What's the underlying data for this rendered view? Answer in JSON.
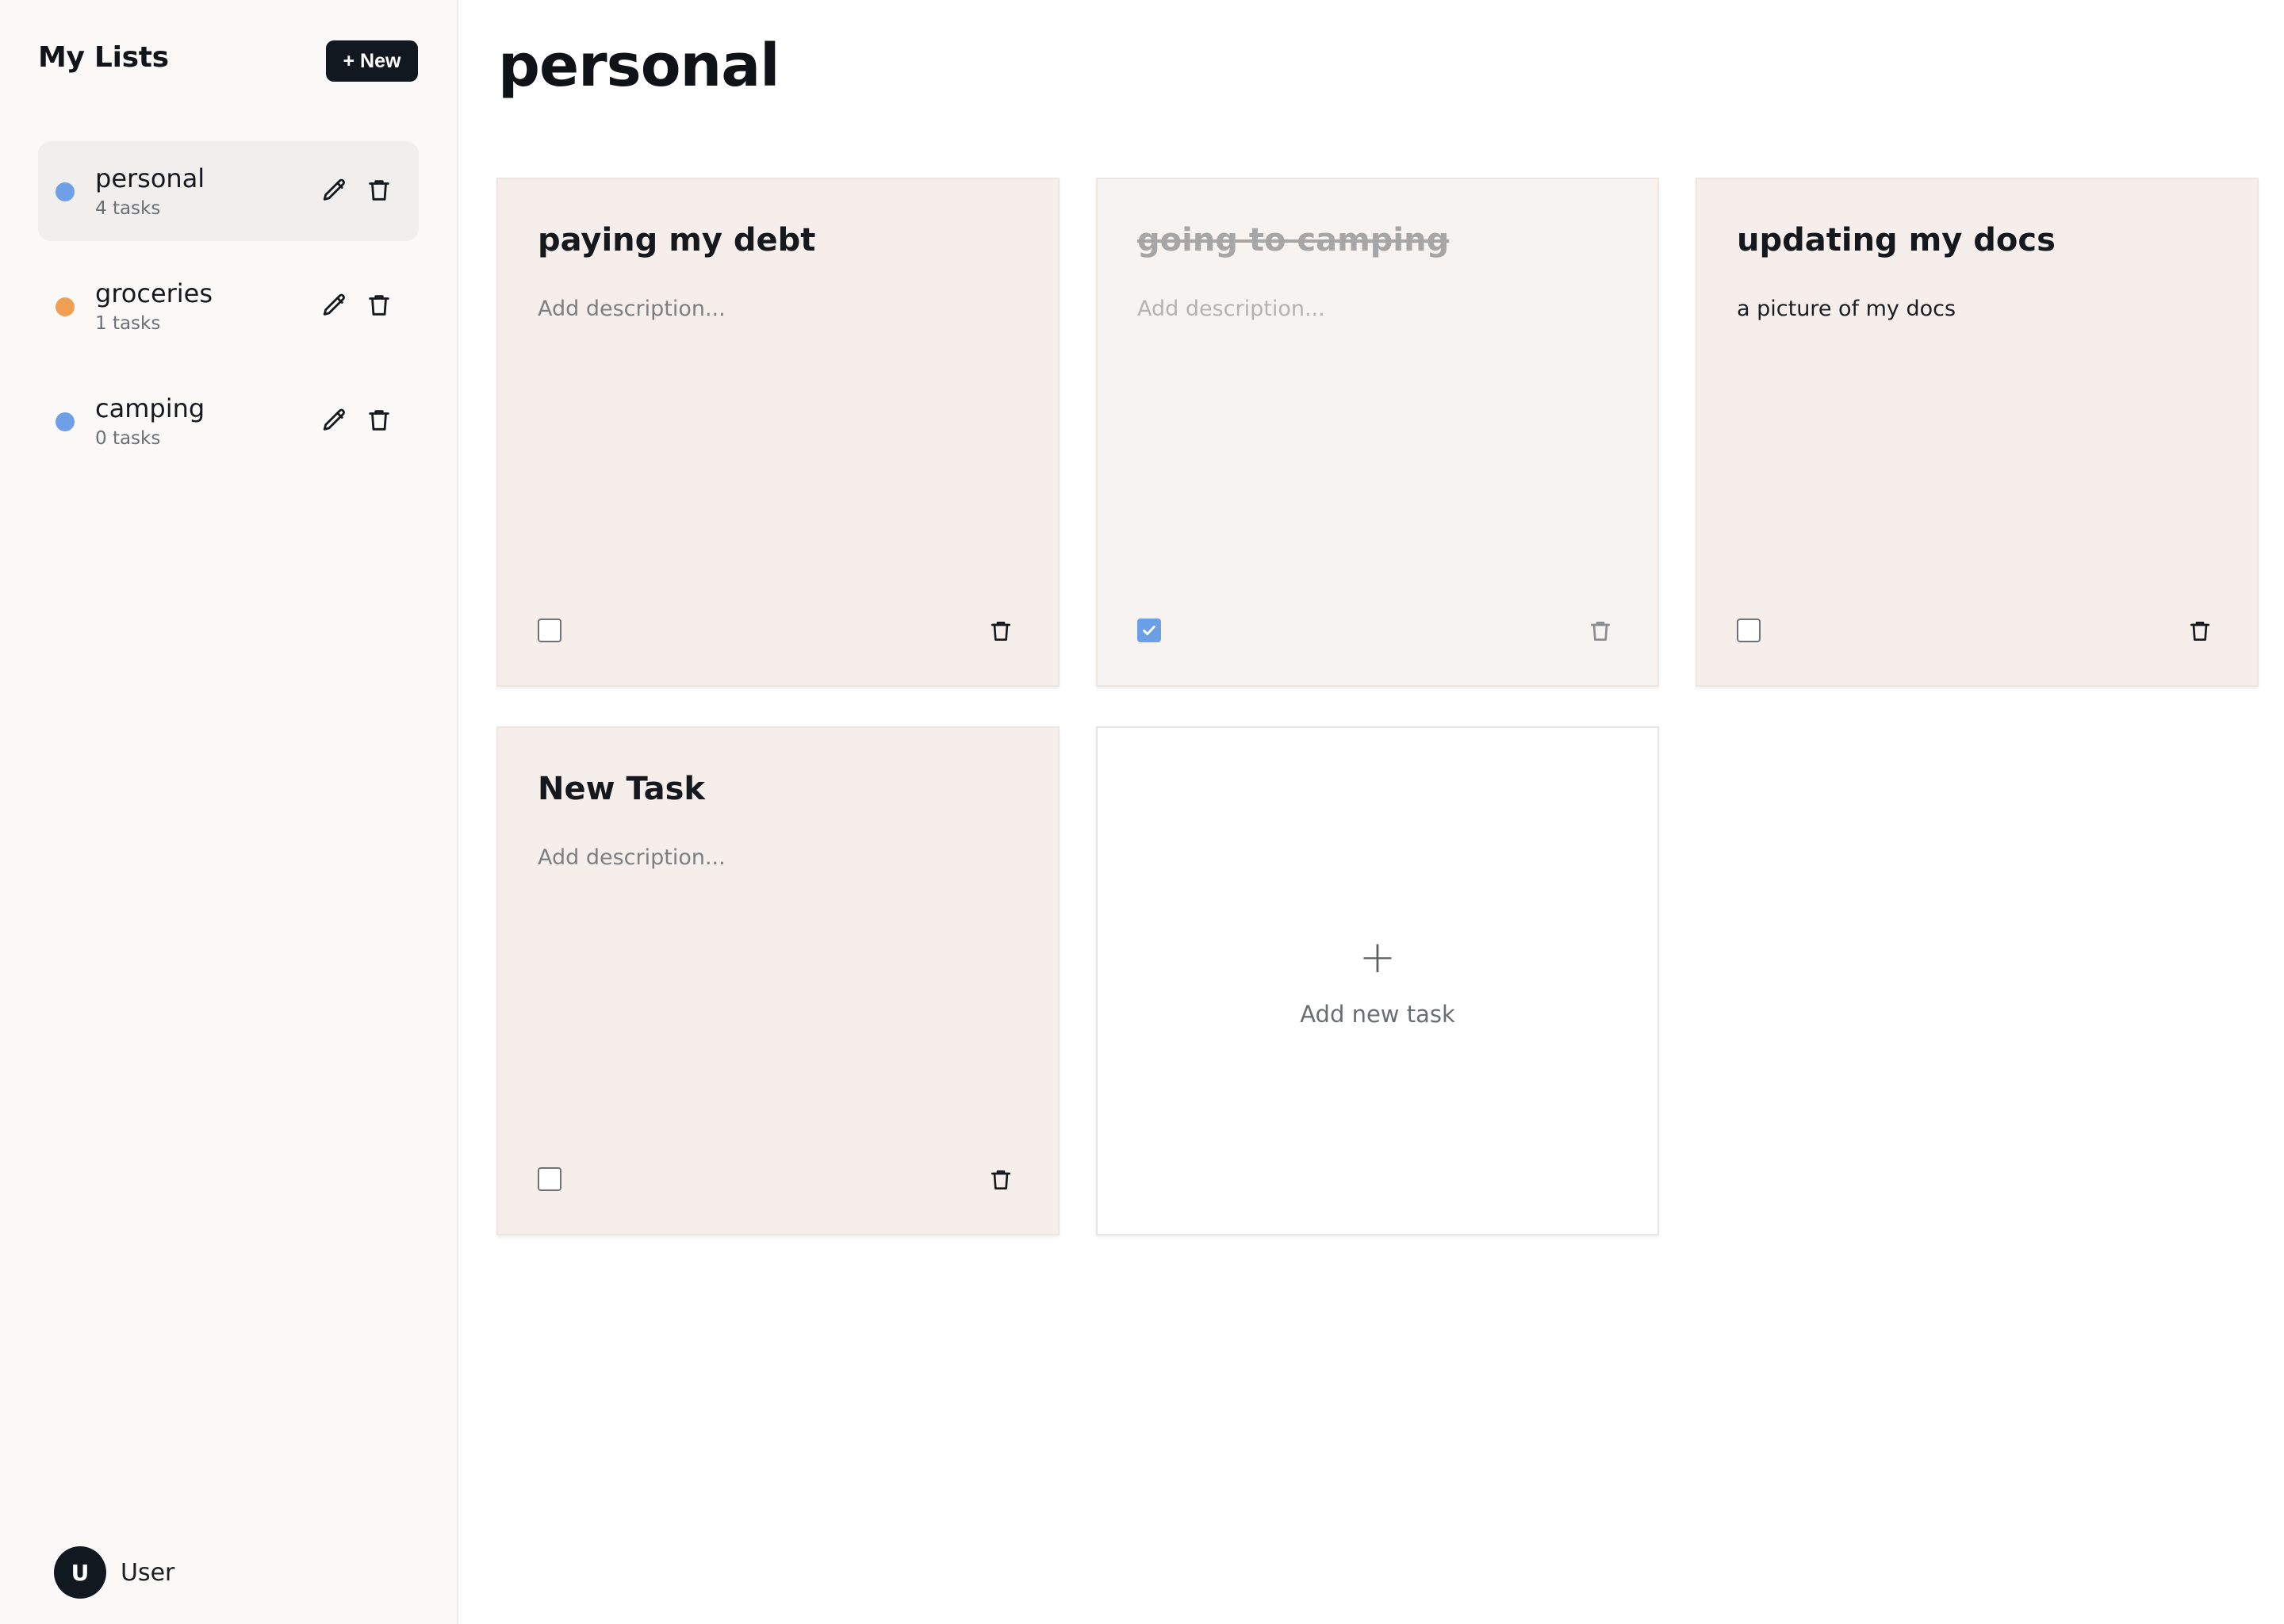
{
  "sidebar": {
    "title": "My Lists",
    "new_button_label": "+ New",
    "lists": [
      {
        "name": "personal",
        "count": "4 tasks",
        "color": "#6f9fe6",
        "active": true
      },
      {
        "name": "groceries",
        "count": "1 tasks",
        "color": "#f0a055",
        "active": false
      },
      {
        "name": "camping",
        "count": "0 tasks",
        "color": "#6f9fe6",
        "active": false
      }
    ],
    "user": {
      "initial": "U",
      "name": "User"
    }
  },
  "main": {
    "title": "personal",
    "tasks": [
      {
        "title": "paying my debt",
        "description": "Add description...",
        "done": false
      },
      {
        "title": "going to camping",
        "description": "Add description...",
        "done": true
      },
      {
        "title": "updating my docs",
        "description": "a picture of my docs",
        "done": false
      },
      {
        "title": "New Task",
        "description": "Add description...",
        "done": false
      }
    ],
    "add_card": {
      "plus": "+",
      "label": "Add new task"
    }
  },
  "colors": {
    "accent": "#6b9fe6",
    "card_bg": "#f5eeea",
    "dark": "#121820"
  },
  "icons": {
    "edit": "pencil-icon",
    "delete": "trash-icon",
    "check": "checkmark-icon"
  }
}
